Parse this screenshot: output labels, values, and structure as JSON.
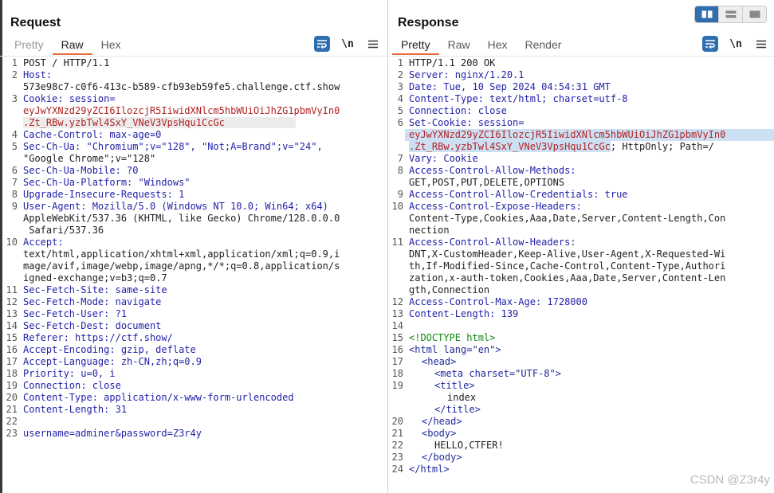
{
  "request": {
    "title": "Request",
    "tabs": [
      "Pretty",
      "Raw",
      "Hex"
    ],
    "active_tab": "Raw",
    "toolbar": {
      "newline_label": "\\n"
    },
    "lines": [
      "POST / HTTP/1.1",
      "Host:",
      "573e98c7-c0f6-413c-b589-cfb93eb59fe5.challenge.ctf.show",
      "Cookie: session=",
      "eyJwYXNzd29yZCI6IlozcjR5IiwidXNlcm5hbWUiOiJhZG1pbmVyIn0",
      ".Zt_RBw.yzbTwl4SxY_VNeV3VpsHqu1CcGc",
      "Cache-Control: max-age=0",
      "Sec-Ch-Ua: \"Chromium\";v=\"128\", \"Not;A=Brand\";v=\"24\",",
      "\"Google Chrome\";v=\"128\"",
      "Sec-Ch-Ua-Mobile: ?0",
      "Sec-Ch-Ua-Platform: \"Windows\"",
      "Upgrade-Insecure-Requests: 1",
      "User-Agent: Mozilla/5.0 (Windows NT 10.0; Win64; x64)",
      "AppleWebKit/537.36 (KHTML, like Gecko) Chrome/128.0.0.0",
      " Safari/537.36",
      "Accept:",
      "text/html,application/xhtml+xml,application/xml;q=0.9,i",
      "mage/avif,image/webp,image/apng,*/*;q=0.8,application/s",
      "igned-exchange;v=b3;q=0.7",
      "Sec-Fetch-Site: same-site",
      "Sec-Fetch-Mode: navigate",
      "Sec-Fetch-User: ?1",
      "Sec-Fetch-Dest: document",
      "Referer: https://ctf.show/",
      "Accept-Encoding: gzip, deflate",
      "Accept-Language: zh-CN,zh;q=0.9",
      "Priority: u=0, i",
      "Connection: close",
      "Content-Type: application/x-www-form-urlencoded",
      "Content-Length: 31",
      "",
      "username=adminer&password=Z3r4y"
    ]
  },
  "response": {
    "title": "Response",
    "tabs": [
      "Pretty",
      "Raw",
      "Hex",
      "Render"
    ],
    "active_tab": "Pretty",
    "toolbar": {
      "newline_label": "\\n"
    },
    "lines": [
      "HTTP/1.1 200 OK",
      "Server: nginx/1.20.1",
      "Date: Tue, 10 Sep 2024 04:54:31 GMT",
      "Content-Type: text/html; charset=utf-8",
      "Connection: close",
      "Set-Cookie: session=",
      "eyJwYXNzd29yZCI6IlozcjR5IiwidXNlcm5hbWUiOiJhZG1pbmVyIn0",
      ".Zt_RBw.yzbTwl4SxY_VNeV3VpsHqu1CcGc",
      "; HttpOnly; Path=/",
      "Vary: Cookie",
      "Access-Control-Allow-Methods:",
      "GET,POST,PUT,DELETE,OPTIONS",
      "Access-Control-Allow-Credentials: true",
      "Access-Control-Expose-Headers:",
      "Content-Type,Cookies,Aaa,Date,Server,Content-Length,Con",
      "nection",
      "Access-Control-Allow-Headers:",
      "DNT,X-CustomHeader,Keep-Alive,User-Agent,X-Requested-Wi",
      "th,If-Modified-Since,Cache-Control,Content-Type,Authori",
      "zation,x-auth-token,Cookies,Aaa,Date,Server,Content-Len",
      "gth,Connection",
      "Access-Control-Max-Age: 1728000",
      "Content-Length: 139",
      "",
      "<!DOCTYPE html>",
      "<html lang=\"en\">",
      "<head>",
      "<meta charset=\"UTF-8\">",
      "<title>",
      "index",
      "</title>",
      "</head>",
      "<body>",
      "HELLO,CTFER!",
      "</body>",
      "</html>"
    ]
  },
  "watermark": "CSDN @Z3r4y"
}
